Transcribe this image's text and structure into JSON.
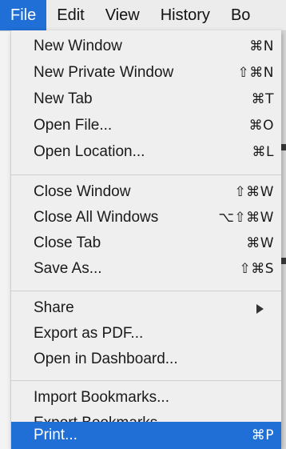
{
  "menubar": {
    "items": [
      {
        "label": "File"
      },
      {
        "label": "Edit"
      },
      {
        "label": "View"
      },
      {
        "label": "History"
      },
      {
        "label": "Bo"
      }
    ]
  },
  "file_menu": {
    "groups": [
      [
        {
          "label": "New Window",
          "shortcut": "⌘N"
        },
        {
          "label": "New Private Window",
          "shortcut": "⇧⌘N"
        },
        {
          "label": "New Tab",
          "shortcut": "⌘T"
        },
        {
          "label": "Open File...",
          "shortcut": "⌘O"
        },
        {
          "label": "Open Location...",
          "shortcut": "⌘L"
        }
      ],
      [
        {
          "label": "Close Window",
          "shortcut": "⇧⌘W"
        },
        {
          "label": "Close All Windows",
          "shortcut": "⌥⇧⌘W"
        },
        {
          "label": "Close Tab",
          "shortcut": "⌘W"
        },
        {
          "label": "Save As...",
          "shortcut": "⇧⌘S"
        }
      ],
      [
        {
          "label": "Share",
          "submenu": true
        },
        {
          "label": "Export as PDF..."
        },
        {
          "label": "Open in Dashboard..."
        }
      ],
      [
        {
          "label": "Import Bookmarks..."
        },
        {
          "label": "Export Bookmarks..."
        }
      ],
      [
        {
          "label": "Print...",
          "shortcut": "⌘P",
          "highlighted": true
        }
      ]
    ]
  },
  "colors": {
    "highlight": "#1f6fd6",
    "menu_bg": "#efefef",
    "text": "#1a1a1a"
  }
}
